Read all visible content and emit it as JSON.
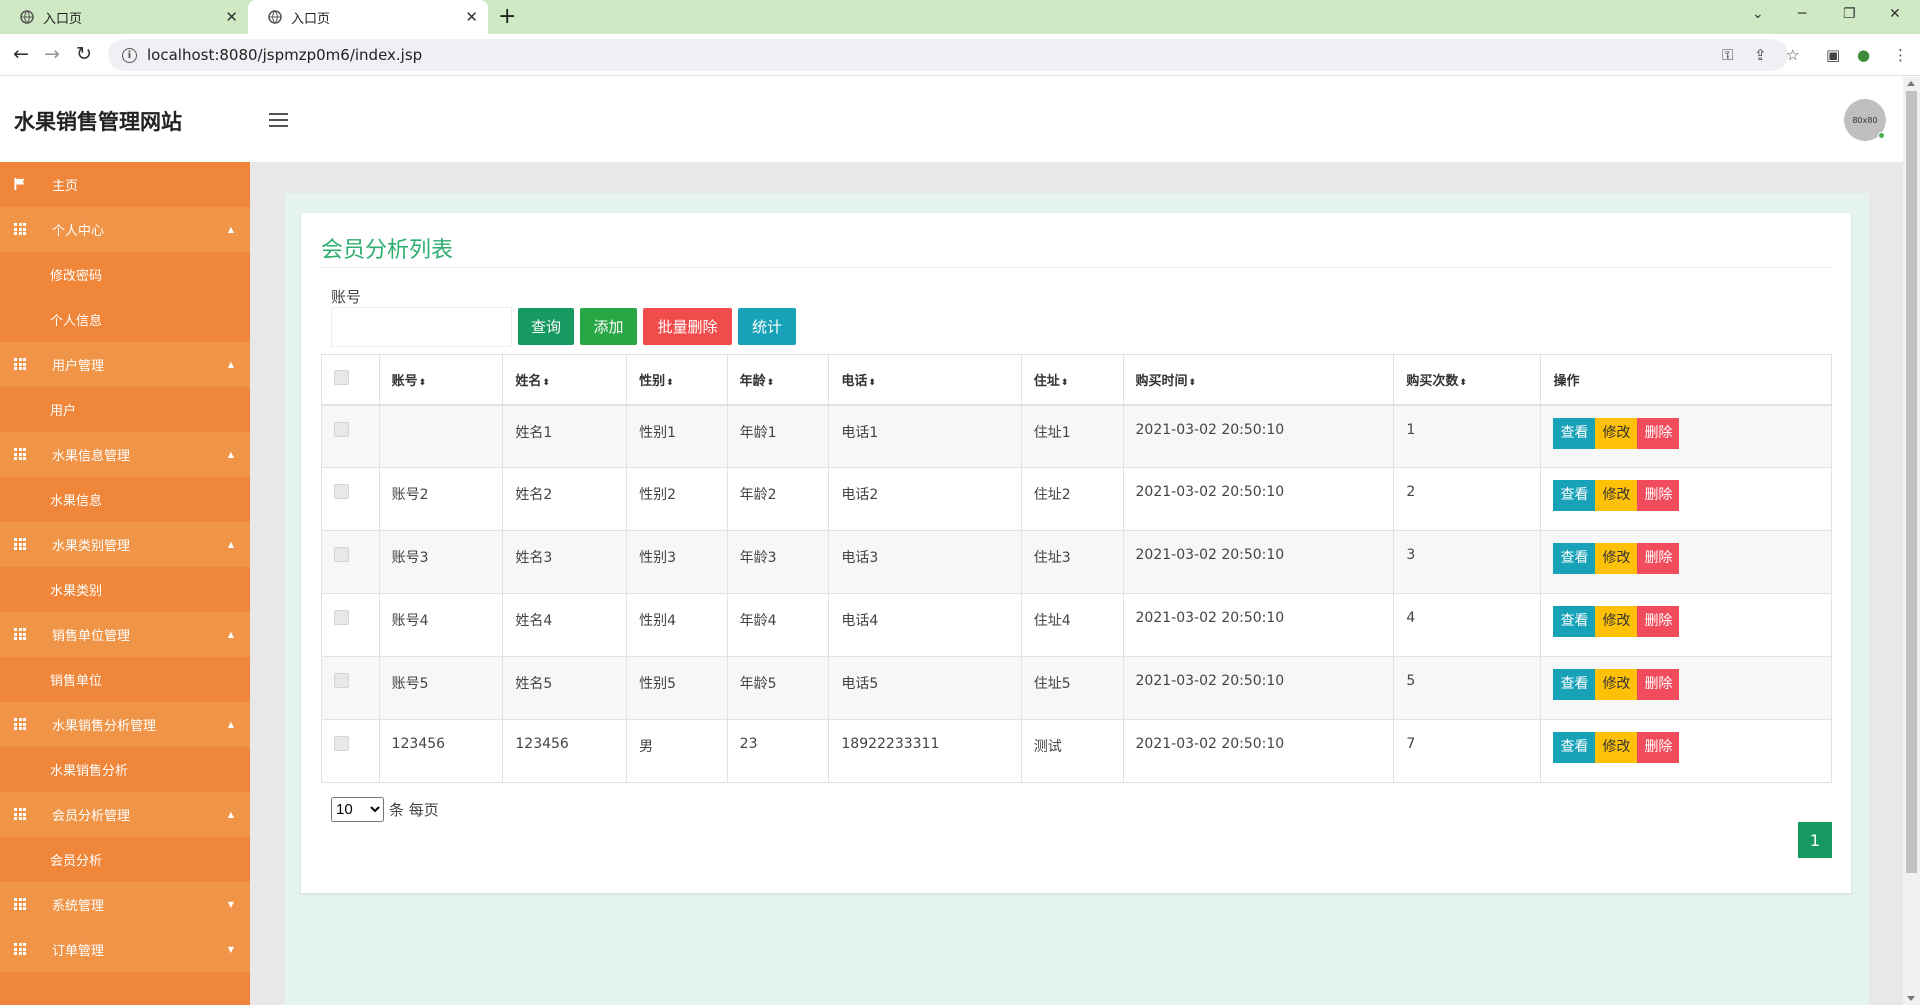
{
  "browser": {
    "tabs": [
      {
        "label": "入口页",
        "active": false
      },
      {
        "label": "入口页",
        "active": true
      }
    ],
    "url": "localhost:8080/jspmzp0m6/index.jsp"
  },
  "header": {
    "brand": "水果销售管理网站",
    "avatar_text": "80x80"
  },
  "sidebar": {
    "items": [
      {
        "label": "主页",
        "type": "home",
        "icon": "flag-icon"
      },
      {
        "label": "个人中心",
        "type": "group",
        "icon": "grid-icon",
        "caret": "up"
      },
      {
        "label": "修改密码",
        "type": "sub"
      },
      {
        "label": "个人信息",
        "type": "sub"
      },
      {
        "label": "用户管理",
        "type": "group",
        "icon": "grid-icon",
        "caret": "up"
      },
      {
        "label": "用户",
        "type": "sub"
      },
      {
        "label": "水果信息管理",
        "type": "group",
        "icon": "grid-icon",
        "caret": "up"
      },
      {
        "label": "水果信息",
        "type": "sub"
      },
      {
        "label": "水果类别管理",
        "type": "group",
        "icon": "grid-icon",
        "caret": "up"
      },
      {
        "label": "水果类别",
        "type": "sub"
      },
      {
        "label": "销售单位管理",
        "type": "group",
        "icon": "grid-icon",
        "caret": "up"
      },
      {
        "label": "销售单位",
        "type": "sub"
      },
      {
        "label": "水果销售分析管理",
        "type": "group",
        "icon": "grid-icon",
        "caret": "up"
      },
      {
        "label": "水果销售分析",
        "type": "sub"
      },
      {
        "label": "会员分析管理",
        "type": "group",
        "icon": "grid-icon",
        "caret": "up"
      },
      {
        "label": "会员分析",
        "type": "sub"
      },
      {
        "label": "系统管理",
        "type": "group",
        "icon": "grid-icon",
        "caret": "down"
      },
      {
        "label": "订单管理",
        "type": "group",
        "icon": "grid-icon",
        "caret": "down"
      }
    ]
  },
  "main": {
    "title": "会员分析列表",
    "search": {
      "label": "账号",
      "value": "",
      "buttons": {
        "query": "查询",
        "add": "添加",
        "batch_delete": "批量删除",
        "stat": "统计"
      }
    },
    "table": {
      "columns": [
        "账号",
        "姓名",
        "性别",
        "年龄",
        "电话",
        "住址",
        "购买时间",
        "购买次数",
        "操作"
      ],
      "rows": [
        [
          "",
          "姓名1",
          "性别1",
          "年龄1",
          "电话1",
          "住址1",
          "2021-03-02 20:50:10",
          "1"
        ],
        [
          "账号2",
          "姓名2",
          "性别2",
          "年龄2",
          "电话2",
          "住址2",
          "2021-03-02 20:50:10",
          "2"
        ],
        [
          "账号3",
          "姓名3",
          "性别3",
          "年龄3",
          "电话3",
          "住址3",
          "2021-03-02 20:50:10",
          "3"
        ],
        [
          "账号4",
          "姓名4",
          "性别4",
          "年龄4",
          "电话4",
          "住址4",
          "2021-03-02 20:50:10",
          "4"
        ],
        [
          "账号5",
          "姓名5",
          "性别5",
          "年龄5",
          "电话5",
          "住址5",
          "2021-03-02 20:50:10",
          "5"
        ],
        [
          "123456",
          "123456",
          "男",
          "23",
          "18922233311",
          "测试",
          "2021-03-02 20:50:10",
          "7"
        ]
      ],
      "actions": {
        "view": "查看",
        "edit": "修改",
        "delete": "删除"
      }
    },
    "pagination": {
      "page_size": "10",
      "page_size_suffix": "条 每页",
      "current_page": "1"
    }
  },
  "colors": {
    "sidebar": "#ef863a",
    "title": "#2eae6f",
    "primary_green": "#179a62",
    "danger": "#f14c4c",
    "info": "#17a2b8",
    "warning": "#ffc107"
  }
}
